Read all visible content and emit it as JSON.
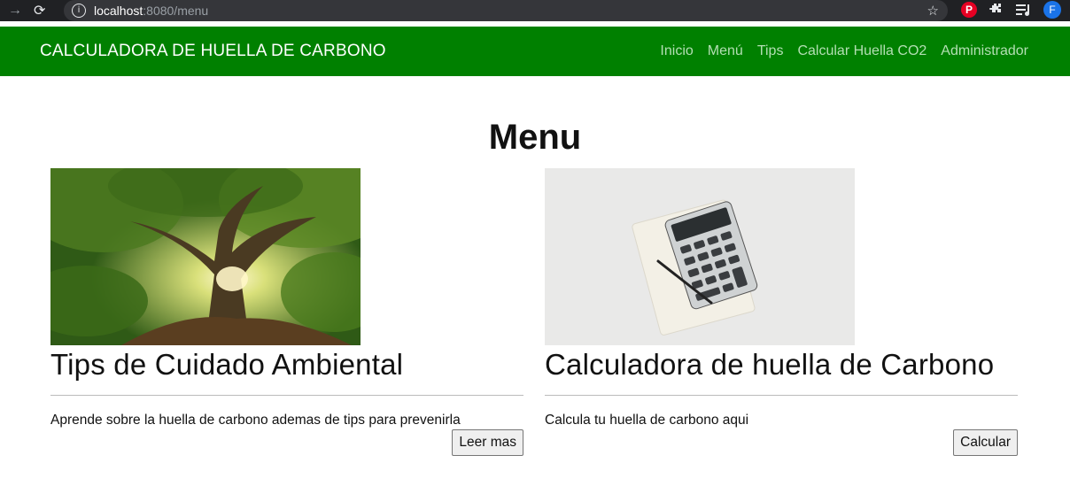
{
  "browser": {
    "url_host": "localhost",
    "url_path": ":8080/menu",
    "profile_initial": "F",
    "pinterest_glyph": "P"
  },
  "navbar": {
    "brand": "CALCULADORA DE HUELLA DE CARBONO",
    "links": [
      "Inicio",
      "Menú",
      "Tips",
      "Calcular Huella CO2",
      "Administrador"
    ]
  },
  "page": {
    "title": "Menu"
  },
  "cards": [
    {
      "title": "Tips de Cuidado Ambiental",
      "text": "Aprende sobre la huella de carbono ademas de tips para prevenirla",
      "button": "Leer mas"
    },
    {
      "title": "Calculadora de huella de Carbono",
      "text": "Calcula tu huella de carbono aqui",
      "button": "Calcular"
    }
  ],
  "colors": {
    "navbar": "#008000",
    "nav_link": "#b3dfb3",
    "chrome": "#202124"
  }
}
